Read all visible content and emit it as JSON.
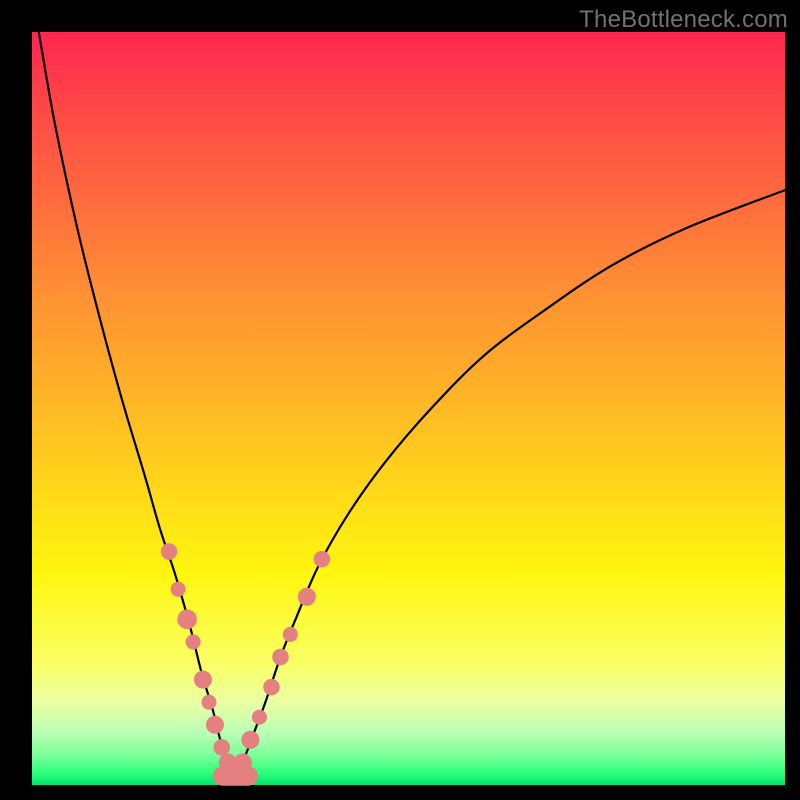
{
  "watermark": "TheBottleneck.com",
  "colors": {
    "frame": "#000000",
    "curve": "#000000",
    "marker": "#e58080",
    "gradient_top": "#ff264f",
    "gradient_bottom": "#00e36b"
  },
  "chart_data": {
    "type": "line",
    "title": "",
    "xlabel": "",
    "ylabel": "",
    "xlim": [
      0,
      100
    ],
    "ylim": [
      0,
      100
    ],
    "grid": false,
    "legend": null,
    "description": "V-shaped curve with minimum near x≈27. Left branch descends steeply from top-left; right branch rises asymptotically toward top-right. Colored markers cluster near the valley on both branches.",
    "series": [
      {
        "name": "left_branch",
        "x": [
          0.9,
          3,
          6,
          9,
          12,
          15,
          17,
          19,
          21,
          22.5,
          24,
          25,
          26,
          27
        ],
        "y": [
          100,
          88,
          74,
          62,
          51,
          41,
          34,
          28,
          21,
          15,
          10,
          6,
          3,
          0.5
        ]
      },
      {
        "name": "right_branch",
        "x": [
          27,
          28,
          29.5,
          31,
          33,
          35,
          38,
          42,
          47,
          53,
          60,
          68,
          77,
          87,
          100
        ],
        "y": [
          0.5,
          3,
          7,
          11,
          17,
          22,
          29,
          36,
          43,
          50,
          57,
          63,
          69,
          74,
          79
        ]
      }
    ],
    "markers": [
      {
        "branch": "left",
        "x": 18.2,
        "y": 31,
        "r": 1.1
      },
      {
        "branch": "left",
        "x": 19.4,
        "y": 26,
        "r": 1.0
      },
      {
        "branch": "left",
        "x": 20.6,
        "y": 22,
        "r": 1.3
      },
      {
        "branch": "left",
        "x": 21.4,
        "y": 19,
        "r": 1.0
      },
      {
        "branch": "left",
        "x": 22.7,
        "y": 14,
        "r": 1.2
      },
      {
        "branch": "left",
        "x": 23.5,
        "y": 11,
        "r": 1.0
      },
      {
        "branch": "left",
        "x": 24.3,
        "y": 8,
        "r": 1.2
      },
      {
        "branch": "left",
        "x": 25.2,
        "y": 5,
        "r": 1.1
      },
      {
        "branch": "left",
        "x": 26.0,
        "y": 3,
        "r": 1.2
      },
      {
        "branch": "right",
        "x": 28.0,
        "y": 3,
        "r": 1.2
      },
      {
        "branch": "right",
        "x": 29.0,
        "y": 6,
        "r": 1.2
      },
      {
        "branch": "right",
        "x": 30.2,
        "y": 9,
        "r": 1.0
      },
      {
        "branch": "right",
        "x": 31.8,
        "y": 13,
        "r": 1.1
      },
      {
        "branch": "right",
        "x": 33.0,
        "y": 17,
        "r": 1.1
      },
      {
        "branch": "right",
        "x": 34.3,
        "y": 20,
        "r": 1.0
      },
      {
        "branch": "right",
        "x": 36.5,
        "y": 25,
        "r": 1.2
      },
      {
        "branch": "right",
        "x": 38.5,
        "y": 30,
        "r": 1.1
      }
    ],
    "valley_capsule": {
      "x0": 25.3,
      "x1": 28.7,
      "y": 1.2,
      "r": 1.3
    }
  }
}
